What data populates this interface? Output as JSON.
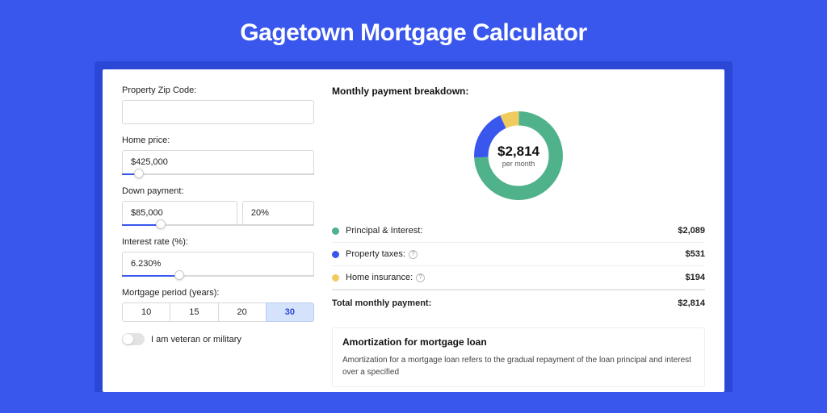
{
  "title": "Gagetown Mortgage Calculator",
  "form": {
    "zip": {
      "label": "Property Zip Code:",
      "value": ""
    },
    "home_price": {
      "label": "Home price:",
      "value": "$425,000",
      "slider_pct": 9
    },
    "down_payment": {
      "label": "Down payment:",
      "amount": "$85,000",
      "percent": "20%",
      "slider_pct": 20
    },
    "interest": {
      "label": "Interest rate (%):",
      "value": "6.230%",
      "slider_pct": 30
    },
    "period": {
      "label": "Mortgage period (years):",
      "options": [
        "10",
        "15",
        "20",
        "30"
      ],
      "selected": "30"
    },
    "veteran": {
      "label": "I am veteran or military",
      "on": false
    }
  },
  "breakdown": {
    "title": "Monthly payment breakdown:",
    "center_amount": "$2,814",
    "center_sub": "per month",
    "items": [
      {
        "key": "pi",
        "label": "Principal & Interest:",
        "value": "$2,089",
        "color": "green",
        "help": false
      },
      {
        "key": "tax",
        "label": "Property taxes:",
        "value": "$531",
        "color": "blue",
        "help": true
      },
      {
        "key": "ins",
        "label": "Home insurance:",
        "value": "$194",
        "color": "yellow",
        "help": true
      }
    ],
    "total": {
      "label": "Total monthly payment:",
      "value": "$2,814"
    }
  },
  "amortization": {
    "title": "Amortization for mortgage loan",
    "text": "Amortization for a mortgage loan refers to the gradual repayment of the loan principal and interest over a specified"
  },
  "chart_data": {
    "type": "pie",
    "title": "Monthly payment breakdown",
    "series": [
      {
        "name": "Principal & Interest",
        "value": 2089,
        "color": "#4fb28a"
      },
      {
        "name": "Property taxes",
        "value": 531,
        "color": "#3957ed"
      },
      {
        "name": "Home insurance",
        "value": 194,
        "color": "#f0cc5f"
      }
    ],
    "total": 2814,
    "center_label": "$2,814 per month"
  }
}
